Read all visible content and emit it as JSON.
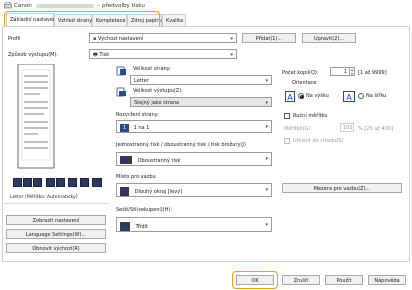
{
  "window": {
    "title_prefix": "Canon",
    "title_suffix": "– předvolby tisku"
  },
  "tabs": [
    {
      "label": "Základní nastavení",
      "active": true
    },
    {
      "label": "Vzhled strany",
      "active": false
    },
    {
      "label": "Kompletace",
      "active": false
    },
    {
      "label": "Zdroj papíru",
      "active": false
    },
    {
      "label": "Kvalita",
      "active": false
    }
  ],
  "profile": {
    "label": "Profil",
    "value": "Výchozí nastavení",
    "add_button": "Přidat(1)...",
    "edit_button": "Upravit(2)..."
  },
  "output_method": {
    "label": "Způsob výstupu(M):",
    "value": "Tisk"
  },
  "page_size": {
    "label": "Velikost strany:",
    "value": "Letter"
  },
  "output_size": {
    "label": "Velikost výstupu(Z):",
    "value": "Stejný jako strana"
  },
  "page_layout": {
    "label": "Rozvržení strany:",
    "value": "1 na 1",
    "icon_number": "1"
  },
  "duplex": {
    "label": "Jednostranný tisk / oboustranný tisk / tisk brožury(J)",
    "value": "Oboustranný tisk"
  },
  "binding": {
    "label": "Místo pro vazbu",
    "value": "Dlouhý okraj [levý]",
    "gutter_button": "Mezera pro vazbu(Z)..."
  },
  "staple": {
    "label": "Sešít/Stl(sekupení)(H):",
    "value": "Třídit"
  },
  "copies": {
    "label": "Počet kopií(Q):",
    "value": "1",
    "range": "[1 až 9999]"
  },
  "orientation": {
    "label": "Orientace",
    "portrait": "Na výšku",
    "landscape": "Na šířku",
    "selected": "portrait"
  },
  "manual_scaling": {
    "label": "Ruční měřítko",
    "scale_label": "Měřítko(G):",
    "scale_value": "100",
    "scale_range": "% [25 až 400]",
    "position_label": "Umístit do středu(S)"
  },
  "preview": {
    "caption": "Letter [Měřítko: Automaticky]"
  },
  "left_buttons": [
    "Zobrazit nastavení",
    "Language Settings(W)...",
    "Obnovit výchozí(R)"
  ],
  "footer": {
    "ok": "OK",
    "cancel": "Zrušit",
    "apply": "Použít",
    "help": "Nápověda"
  },
  "colors": {
    "highlight": "#f0a020",
    "icon_dark": "#2d3a5c",
    "accent_blue": "#2a4d8a"
  }
}
